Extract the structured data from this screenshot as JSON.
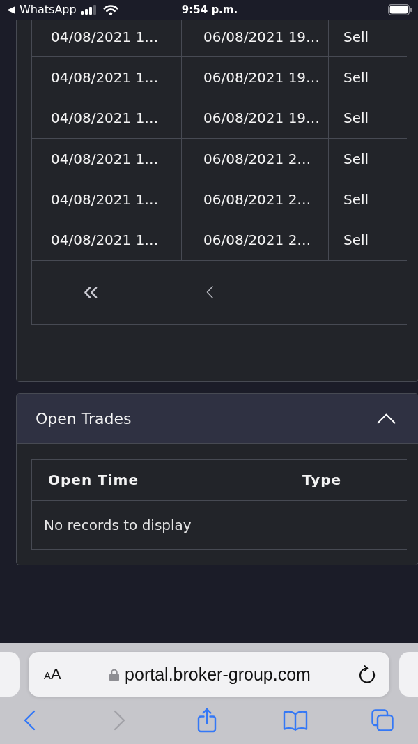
{
  "status_bar": {
    "back_label": "WhatsApp",
    "time": "9:54 p.m."
  },
  "trade_history": {
    "rows": [
      [
        "04/08/2021 1…",
        "06/08/2021 19…",
        "Sell"
      ],
      [
        "04/08/2021 1…",
        "06/08/2021 19…",
        "Sell"
      ],
      [
        "04/08/2021 1…",
        "06/08/2021 19…",
        "Sell"
      ],
      [
        "04/08/2021 1…",
        "06/08/2021 2…",
        "Sell"
      ],
      [
        "04/08/2021 1…",
        "06/08/2021 2…",
        "Sell"
      ],
      [
        "04/08/2021 1…",
        "06/08/2021 2…",
        "Sell"
      ]
    ]
  },
  "open_trades": {
    "title": "Open Trades",
    "expanded": true,
    "columns": [
      "Open Time",
      "Type"
    ],
    "empty_message": "No records to display"
  },
  "browser": {
    "text_size": "AA",
    "url": "portal.broker-group.com",
    "toolbar": [
      {
        "kind": "back",
        "disabled": false
      },
      {
        "kind": "forward",
        "disabled": true
      },
      {
        "kind": "share",
        "disabled": false
      },
      {
        "kind": "bookmarks",
        "disabled": false
      },
      {
        "kind": "tabs",
        "disabled": false
      }
    ]
  }
}
